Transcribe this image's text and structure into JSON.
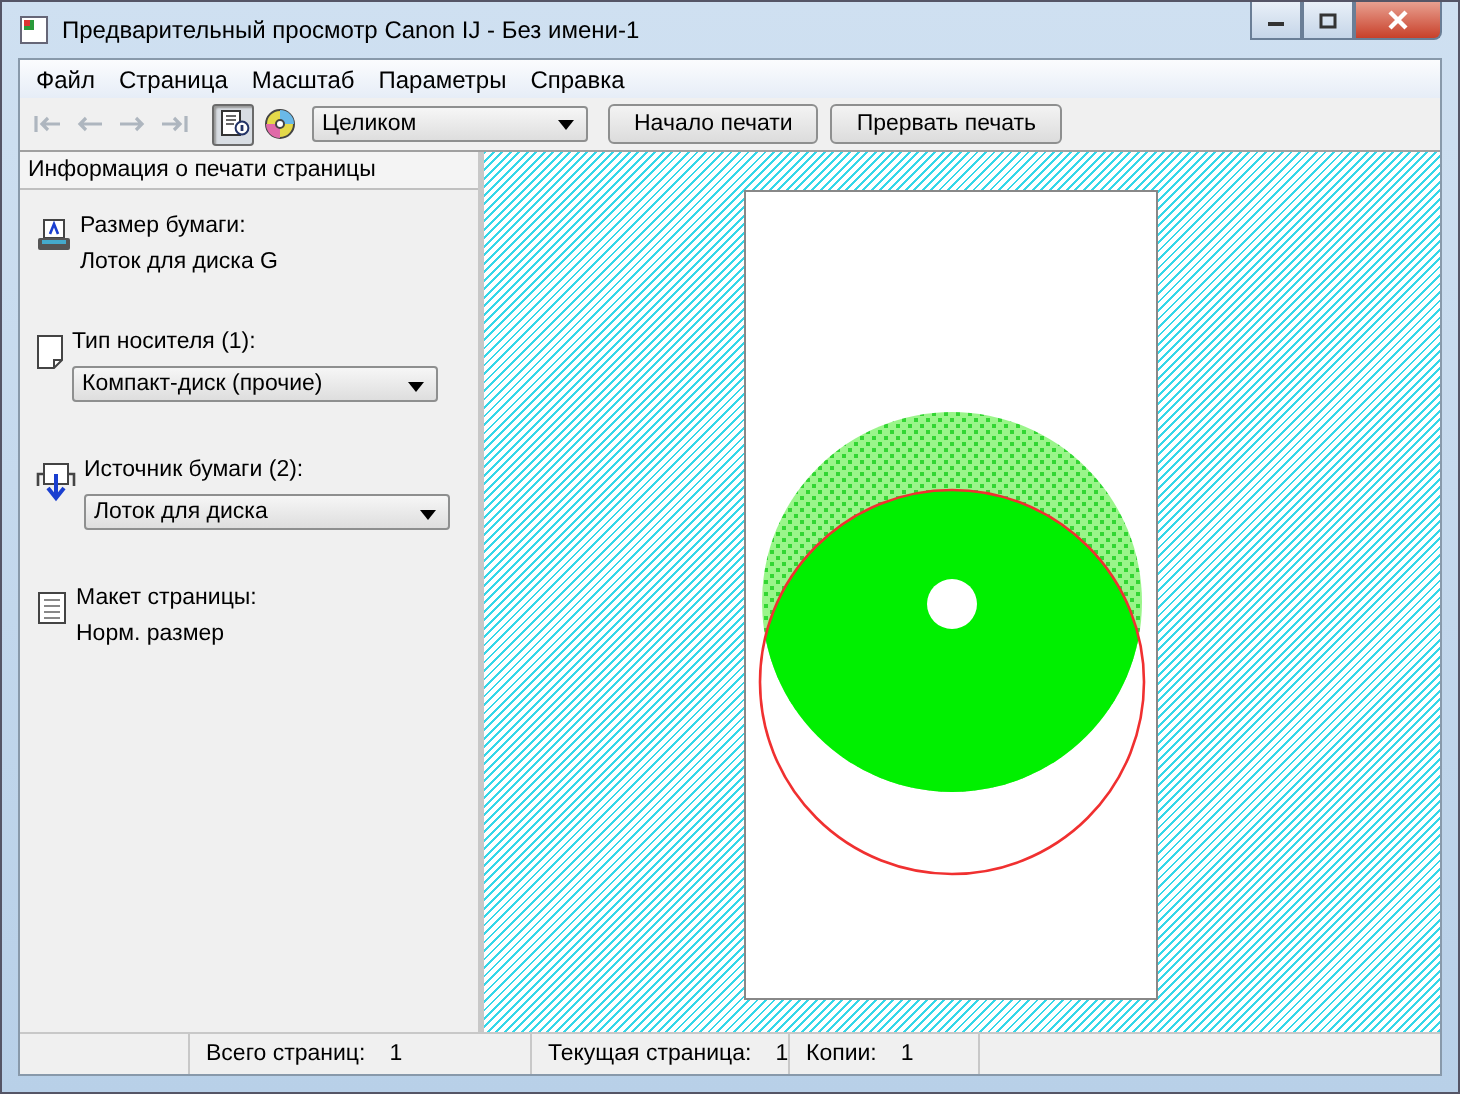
{
  "window": {
    "title": "Предварительный просмотр Canon IJ - Без имени-1"
  },
  "menu": [
    "Файл",
    "Страница",
    "Масштаб",
    "Параметры",
    "Справка"
  ],
  "toolbar": {
    "nav_buttons": [
      {
        "kind": "first",
        "disabled": true
      },
      {
        "kind": "prev",
        "disabled": true
      },
      {
        "kind": "next",
        "disabled": true
      },
      {
        "kind": "last",
        "disabled": true
      }
    ],
    "toggles": [
      {
        "kind": "info",
        "selected": true
      },
      {
        "kind": "disc",
        "selected": false
      }
    ],
    "zoom_select": "Целиком",
    "buttons": [
      "Начало печати",
      "Прервать печать"
    ]
  },
  "panel": {
    "title": "Информация о печати страницы",
    "items": [
      {
        "kind": "paper-size",
        "label": "Размер бумаги:",
        "value": "Лоток для диска G"
      },
      {
        "kind": "media",
        "label": "Тип носителя (1):",
        "select": "Компакт-диск (прочие)"
      },
      {
        "kind": "source",
        "label": "Источник бумаги (2):",
        "select": "Лоток для диска"
      },
      {
        "kind": "layout",
        "label": "Макет страницы:",
        "value": "Норм. размер"
      }
    ]
  },
  "status_bar": [
    {
      "label": "Всего страниц:",
      "value": "1"
    },
    {
      "label": "Текущая страница:",
      "value": "1"
    },
    {
      "label": "Копии:",
      "value": "1"
    }
  ]
}
